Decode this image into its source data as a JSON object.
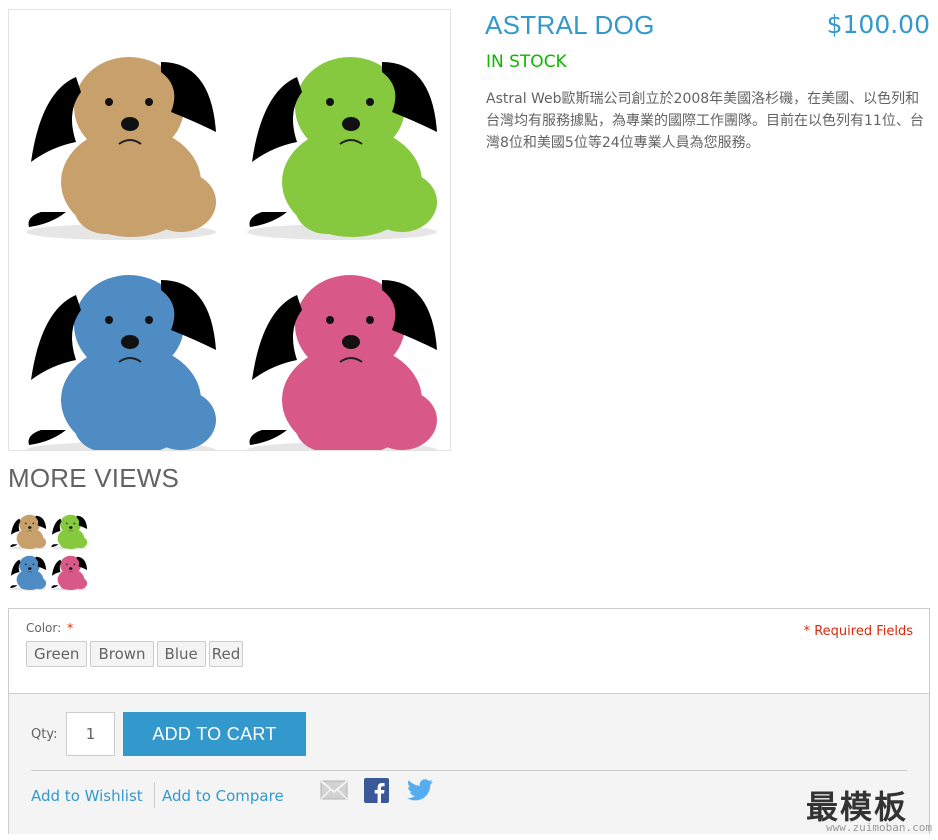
{
  "product": {
    "name": "ASTRAL DOG",
    "price": "$100.00",
    "stock": "IN STOCK",
    "description": "Astral Web歐斯瑞公司創立於2008年美國洛杉磯，在美國、以色列和台灣均有服務據點，為專業的國際工作團隊。目前在以色列有11位、台灣8位和美國5位等24位專業人員為您服務。"
  },
  "images": {
    "main_alt_colors": [
      "#c8a06b",
      "#86c83e",
      "#4f8cc4",
      "#d85987"
    ],
    "ear_colors": [
      "#8a5a2e",
      "#4a8a26",
      "#2c5f95",
      "#a8294f"
    ]
  },
  "more_views": {
    "title": "MORE VIEWS",
    "thumbnails": [
      "brown-dog",
      "green-dog",
      "blue-dog",
      "pink-dog"
    ]
  },
  "options": {
    "color_label": "Color:",
    "required_star": "*",
    "required_note": "* Required Fields",
    "swatches": [
      "Green",
      "Brown",
      "Blue",
      "Red"
    ]
  },
  "cart": {
    "qty_label": "Qty:",
    "qty_value": "1",
    "add_to_cart_label": "ADD TO CART"
  },
  "links": {
    "wishlist": "Add to Wishlist",
    "compare": "Add to Compare"
  },
  "share_icons": [
    "email-icon",
    "facebook-icon",
    "twitter-icon"
  ],
  "colors": {
    "accent": "#3399cc",
    "in_stock": "#11b400",
    "required": "#df280a"
  },
  "watermark": {
    "brand": "最模板",
    "url": "www.zuimoban.com"
  }
}
